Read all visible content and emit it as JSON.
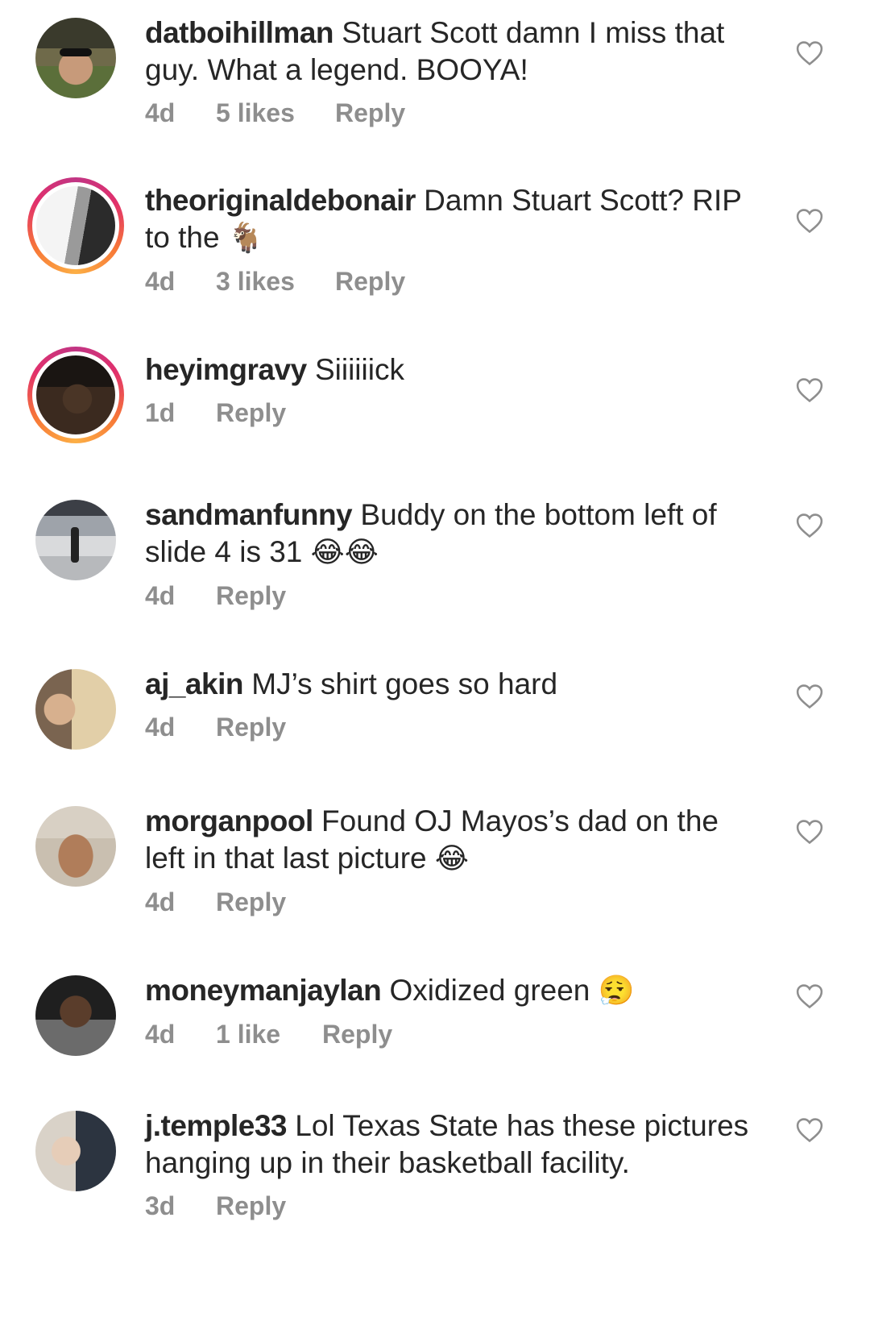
{
  "comments": [
    {
      "username": "datboihillman",
      "text": "Stuart Scott damn I miss that guy. What a legend. BOOYA!",
      "time": "4d",
      "likes": "5 likes",
      "reply": "Reply"
    },
    {
      "username": "theoriginaldebonair",
      "text": "Damn Stuart Scott? RIP to the",
      "emoji": "🐐",
      "time": "4d",
      "likes": "3 likes",
      "reply": "Reply"
    },
    {
      "username": "heyimgravy",
      "text": "Siiiiiick",
      "time": "1d",
      "reply": "Reply"
    },
    {
      "username": "sandmanfunny",
      "text": "Buddy on the bottom left of slide 4 is 31",
      "emoji": "😂😂",
      "time": "4d",
      "reply": "Reply"
    },
    {
      "username": "aj_akin",
      "text": "MJ’s shirt goes so hard",
      "time": "4d",
      "reply": "Reply"
    },
    {
      "username": "morganpool",
      "text": "Found OJ Mayos’s dad on the left in that last picture",
      "emoji": "😂",
      "time": "4d",
      "reply": "Reply"
    },
    {
      "username": "moneymanjaylan",
      "text": "Oxidized green",
      "emoji": "😮‍💨",
      "time": "4d",
      "likes": "1 like",
      "reply": "Reply"
    },
    {
      "username": "j.temple33",
      "text": "Lol Texas State has these pictures hanging up in their basketball facility.",
      "time": "3d",
      "reply": "Reply"
    }
  ],
  "icons": {
    "like": "heart-outline-icon"
  },
  "colors": {
    "secondary_text": "#8e8e8e",
    "primary_text": "#262626",
    "story_ring": "#e1306c"
  }
}
